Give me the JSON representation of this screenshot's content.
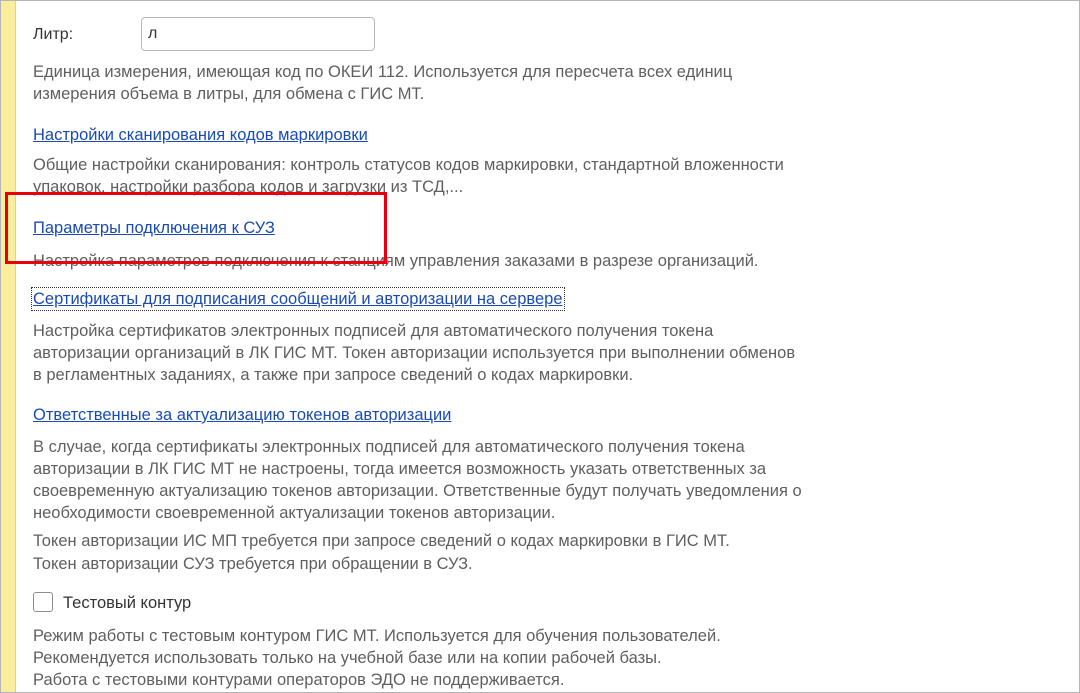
{
  "litr_field": {
    "label": "Литр:",
    "value": "л"
  },
  "litr_description": [
    "Единица измерения, имеющая код по ОКЕИ 112. Используется для пересчета всех единиц",
    "измерения объема в литры, для обмена с ГИС МТ."
  ],
  "scan_settings": {
    "link": "Настройки сканирования кодов маркировки",
    "description": [
      "Общие настройки сканирования: контроль статусов кодов маркировки, стандартной вложенности",
      "упаковок, настройки разбора кодов и загрузки из ТСД,..."
    ]
  },
  "suz_params": {
    "link": "Параметры подключения к СУЗ",
    "description": "Настройка параметров подключения к станциям управления заказами в разрезе организаций."
  },
  "certificates": {
    "link": "Сертификаты для подписания сообщений и авторизации на сервере",
    "description": [
      "Настройка сертификатов электронных подписей для автоматического получения токена",
      "авторизации организаций в ЛК ГИС МТ. Токен авторизации используется при выполнении обменов",
      "в регламентных заданиях, а также при запросе сведений о кодах маркировки."
    ]
  },
  "responsible": {
    "link": "Ответственные за актуализацию токенов авторизации",
    "description": [
      "В случае, когда сертификаты электронных подписей для автоматического получения токена",
      "авторизации в ЛК ГИС МТ не настроены, тогда имеется возможность указать ответственных за",
      "своевременную актуализацию токенов авторизации. Ответственные будут получать уведомления о",
      "необходимости своевременной актуализации токенов авторизации.",
      "Токен авторизации ИС МП требуется при запросе сведений о кодах маркировки в ГИС МТ.",
      "Токен авторизации СУЗ требуется при обращении в СУЗ."
    ]
  },
  "test_contour": {
    "label": "Тестовый контур",
    "checked": false,
    "description": [
      "Режим работы с тестовым контуром ГИС МТ. Используется для обучения пользователей.",
      "Рекомендуется использовать только на учебной базе или на копии рабочей базы.",
      "Работа с тестовыми контурами операторов ЭДО не поддерживается."
    ]
  },
  "colors": {
    "link": "#1a4bb4",
    "description_text": "#5f5f5f",
    "highlight": "#e8000c",
    "left_bar": "#fbed9e"
  }
}
